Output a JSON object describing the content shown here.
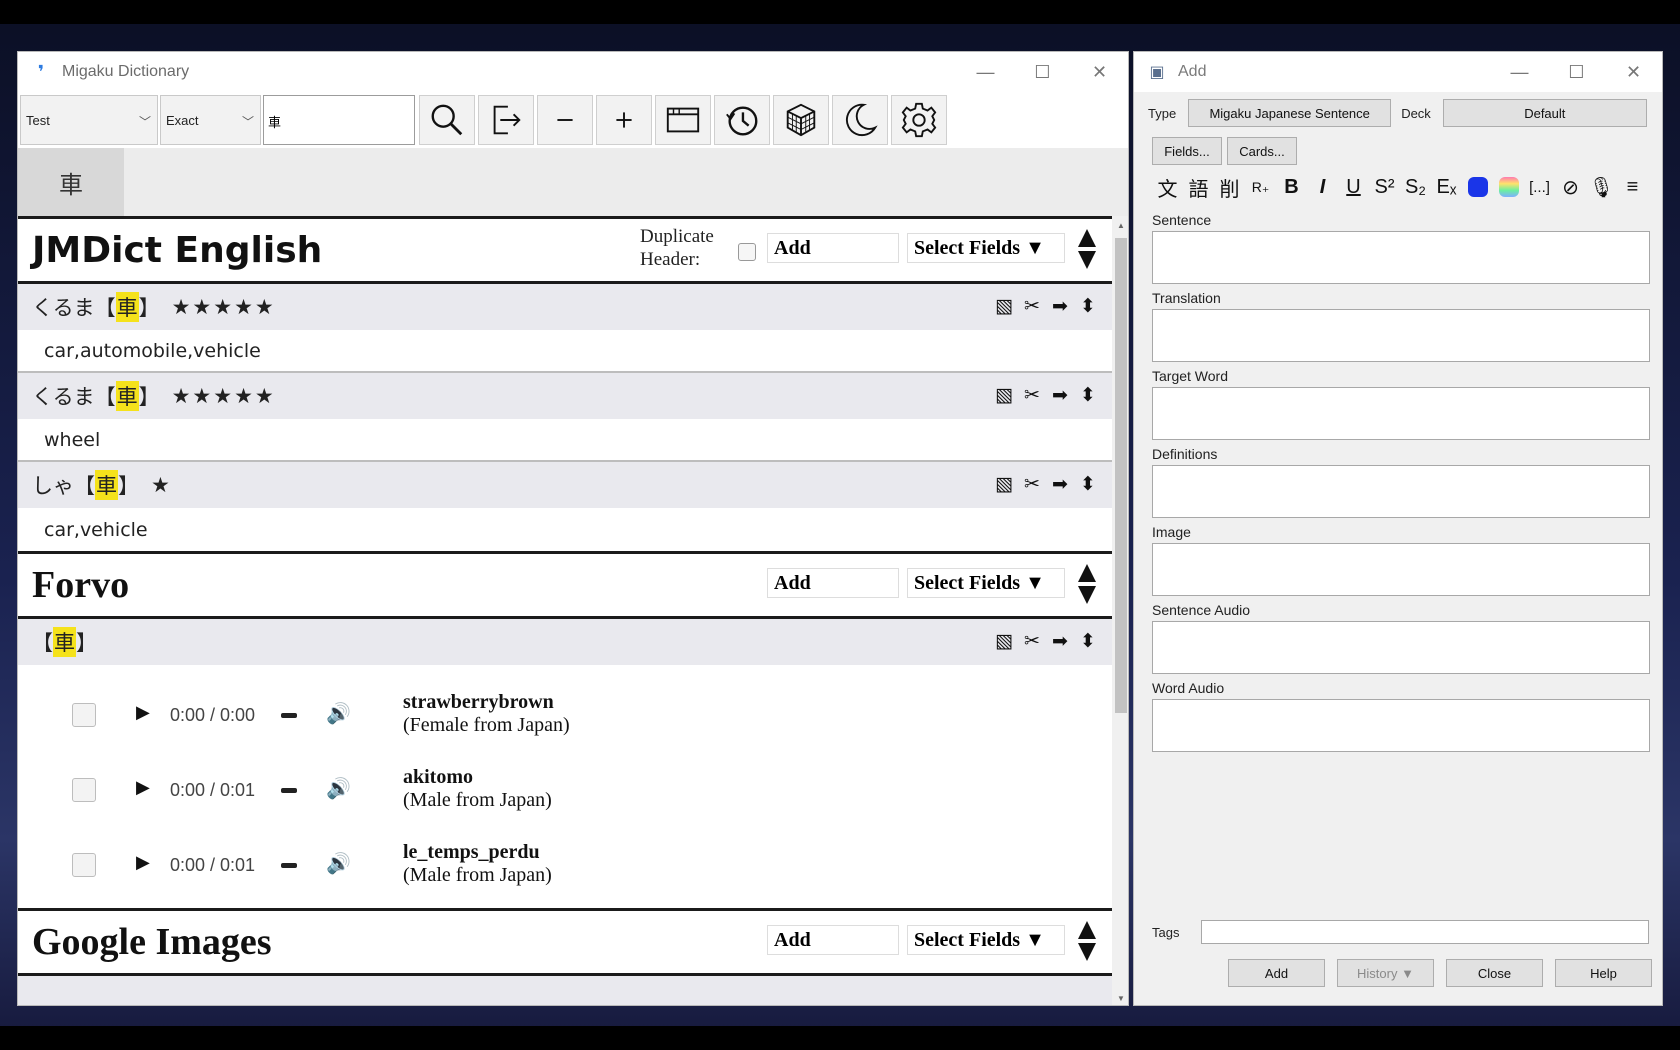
{
  "dictionary": {
    "window_title": "Migaku Dictionary",
    "dict_select": "Test",
    "match_select": "Exact",
    "search_value": "車",
    "active_tab": "車",
    "sections": {
      "jmdict": {
        "title": "JMDict English",
        "duplicate_header_label_1": "Duplicate",
        "duplicate_header_label_2": "Header:",
        "add_label": "Add",
        "select_fields_label": "Select Fields ▼",
        "entries": [
          {
            "reading": "くるま",
            "lb": "【",
            "kanji": "車",
            "rb": "】",
            "stars": "★★★★★",
            "definition": "car,automobile,vehicle"
          },
          {
            "reading": "くるま",
            "lb": "【",
            "kanji": "車",
            "rb": "】",
            "stars": "★★★★★",
            "definition": "wheel"
          },
          {
            "reading": "しゃ",
            "lb": "【",
            "kanji": "車",
            "rb": "】",
            "stars": "★",
            "definition": "car,vehicle"
          }
        ]
      },
      "forvo": {
        "title": "Forvo",
        "add_label": "Add",
        "select_fields_label": "Select Fields ▼",
        "entry": {
          "lb": "【",
          "kanji": "車",
          "rb": "】"
        },
        "recordings": [
          {
            "time": "0:00 / 0:00",
            "user": "strawberrybrown",
            "origin": "(Female from Japan)"
          },
          {
            "time": "0:00 / 0:01",
            "user": "akitomo",
            "origin": "(Male from Japan)"
          },
          {
            "time": "0:00 / 0:01",
            "user": "le_temps_perdu",
            "origin": "(Male from Japan)"
          }
        ]
      },
      "google_images": {
        "title": "Google Images",
        "add_label": "Add",
        "select_fields_label": "Select Fields ▼"
      }
    }
  },
  "add_window": {
    "window_title": "Add",
    "type_label": "Type",
    "type_value": "Migaku Japanese Sentence",
    "deck_label": "Deck",
    "deck_value": "Default",
    "fields_button": "Fields...",
    "cards_button": "Cards...",
    "format_buttons": [
      "文",
      "語",
      "削",
      "R₊",
      "B",
      "I",
      "U",
      "S²",
      "S₂",
      "Eₓ"
    ],
    "field_labels": [
      "Sentence",
      "Translation",
      "Target Word",
      "Definitions",
      "Image",
      "Sentence Audio",
      "Word Audio"
    ],
    "tags_label": "Tags",
    "buttons": {
      "add": "Add",
      "history": "History ▼",
      "close": "Close",
      "help": "Help"
    }
  },
  "colors": {
    "highlight": "#f5e21b",
    "accent_blue": "#1a35e8"
  }
}
